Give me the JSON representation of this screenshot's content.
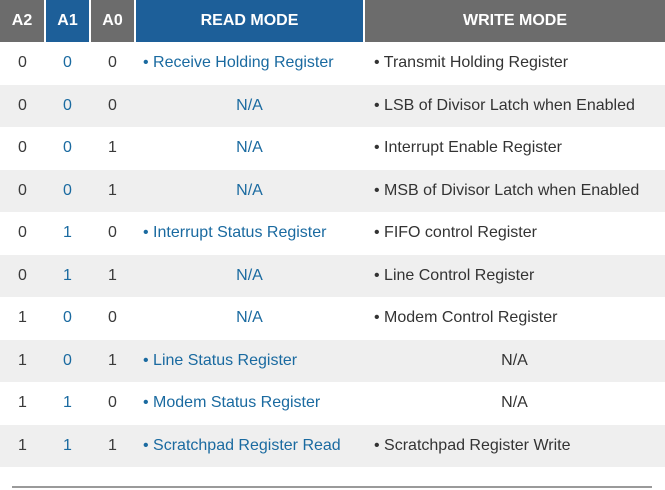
{
  "headers": {
    "a2": "A2",
    "a1": "A1",
    "a0": "A0",
    "read": "READ MODE",
    "write": "WRITE MODE"
  },
  "colors": {
    "header_gray": "#6c6c6c",
    "header_blue": "#1d5f99",
    "link_blue": "#1a6aa0",
    "row_alt": "#efefef"
  },
  "rows": [
    {
      "a2": "0",
      "a1": "0",
      "a0": "0",
      "read": "• Receive Holding Register",
      "write": "• Transmit Holding Register"
    },
    {
      "a2": "0",
      "a1": "0",
      "a0": "0",
      "read": "N/A",
      "write": "• LSB of Divisor Latch when Enabled"
    },
    {
      "a2": "0",
      "a1": "0",
      "a0": "1",
      "read": "N/A",
      "write": "• Interrupt Enable Register"
    },
    {
      "a2": "0",
      "a1": "0",
      "a0": "1",
      "read": "N/A",
      "write": "• MSB of Divisor Latch when Enabled"
    },
    {
      "a2": "0",
      "a1": "1",
      "a0": "0",
      "read": "• Interrupt Status Register",
      "write": "• FIFO control Register"
    },
    {
      "a2": "0",
      "a1": "1",
      "a0": "1",
      "read": "N/A",
      "write": "• Line Control Register"
    },
    {
      "a2": "1",
      "a1": "0",
      "a0": "0",
      "read": "N/A",
      "write": "• Modem Control Register"
    },
    {
      "a2": "1",
      "a1": "0",
      "a0": "1",
      "read": "• Line Status Register",
      "write": "N/A"
    },
    {
      "a2": "1",
      "a1": "1",
      "a0": "0",
      "read": "• Modem Status Register",
      "write": "N/A"
    },
    {
      "a2": "1",
      "a1": "1",
      "a0": "1",
      "read": "• Scratchpad Register Read",
      "write": "• Scratchpad Register Write"
    }
  ]
}
